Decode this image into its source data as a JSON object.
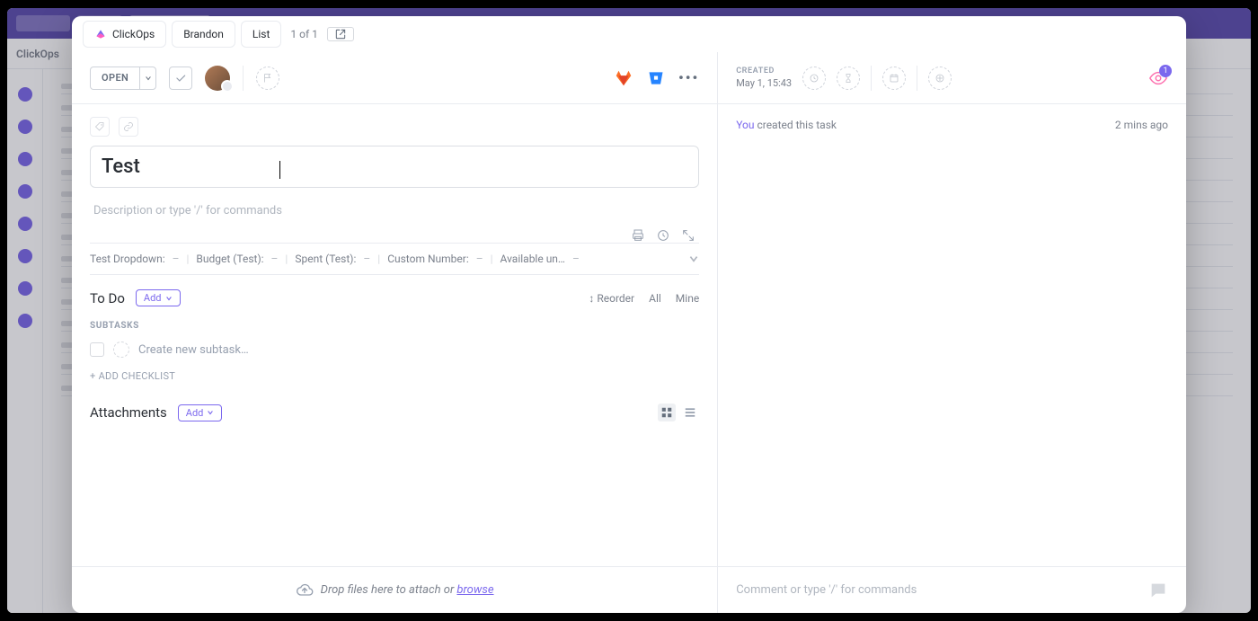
{
  "breadcrumbs": {
    "workspace": "ClickOps",
    "space": "Brandon",
    "list": "List",
    "position": "1 of 1"
  },
  "task": {
    "status": "OPEN",
    "title": "Test",
    "description_placeholder": "Description or type '/' for commands"
  },
  "custom_fields": [
    {
      "label": "Test Dropdown:",
      "value": "–"
    },
    {
      "label": "Budget (Test):",
      "value": "–"
    },
    {
      "label": "Spent (Test):",
      "value": "–"
    },
    {
      "label": "Custom Number:",
      "value": "–"
    },
    {
      "label": "Available un…",
      "value": "–"
    }
  ],
  "todo": {
    "title": "To Do",
    "add": "Add",
    "reorder": "Reorder",
    "all": "All",
    "mine": "Mine",
    "subtasks_label": "SUBTASKS",
    "new_subtask_placeholder": "Create new subtask…",
    "add_checklist": "+ ADD CHECKLIST"
  },
  "attachments": {
    "title": "Attachments",
    "add": "Add"
  },
  "dropzone": {
    "text": "Drop files here to attach or ",
    "link": "browse"
  },
  "right": {
    "created_label": "CREATED",
    "created_value": "May 1, 15:43",
    "watchers": "1",
    "activity_you": "You",
    "activity_text": " created this task",
    "activity_time": "2 mins ago",
    "comment_placeholder": "Comment or type '/' for commands"
  },
  "bg": {
    "title": "ClickOps"
  }
}
